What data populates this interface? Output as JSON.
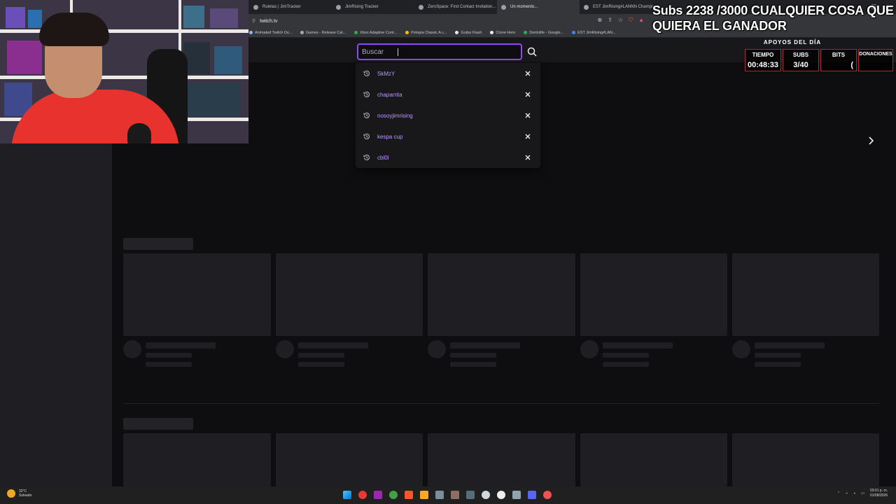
{
  "browser": {
    "tabs": [
      {
        "label": "Ruletas | JimTracker",
        "active": false
      },
      {
        "label": "JimRising Tracker",
        "active": false
      },
      {
        "label": "ZeroSpace: First Contact Invitation...",
        "active": false
      },
      {
        "label": "Un momento...",
        "active": true
      },
      {
        "label": "EST JimRising#LANNN Champion...",
        "active": false
      }
    ],
    "url": "twitch.tv",
    "bookmarks": [
      "Animated Twitch Ov...",
      "Games - Release Cal...",
      "Xbox Adaptive Cont...",
      "Petopia Classic A c...",
      "Guitar Flash",
      "Clone Hero",
      "Dentolife - Google...",
      "EST JimRising#LAN..."
    ]
  },
  "search": {
    "placeholder": "Buscar",
    "value": "",
    "history": [
      "SkMzY",
      "chaparrita",
      "nosoyjimrising",
      "kespa cup",
      "cbl0l"
    ]
  },
  "overlay": {
    "banner": "Subs 2238 /3000 CUALQUIER COSA QUE QUIERA EL GANADOR",
    "apoyos_title": "APOYOS DEL DÍA",
    "stats": [
      {
        "label": "TIEMPO",
        "value": "00:48:33"
      },
      {
        "label": "SUBS",
        "value": "3/40"
      },
      {
        "label": "BITS",
        "value": "("
      },
      {
        "label": "DONACIONES",
        "value": ""
      }
    ]
  },
  "taskbar": {
    "weather_temp": "32°C",
    "weather_desc": "Soleado",
    "time": "03:01 p. m.",
    "date": "01/08/2026"
  },
  "colors": {
    "accent": "#9147ff",
    "history_text": "#bf94ff",
    "skeleton": "#1f1f23",
    "banner_border": "#b0242a"
  }
}
